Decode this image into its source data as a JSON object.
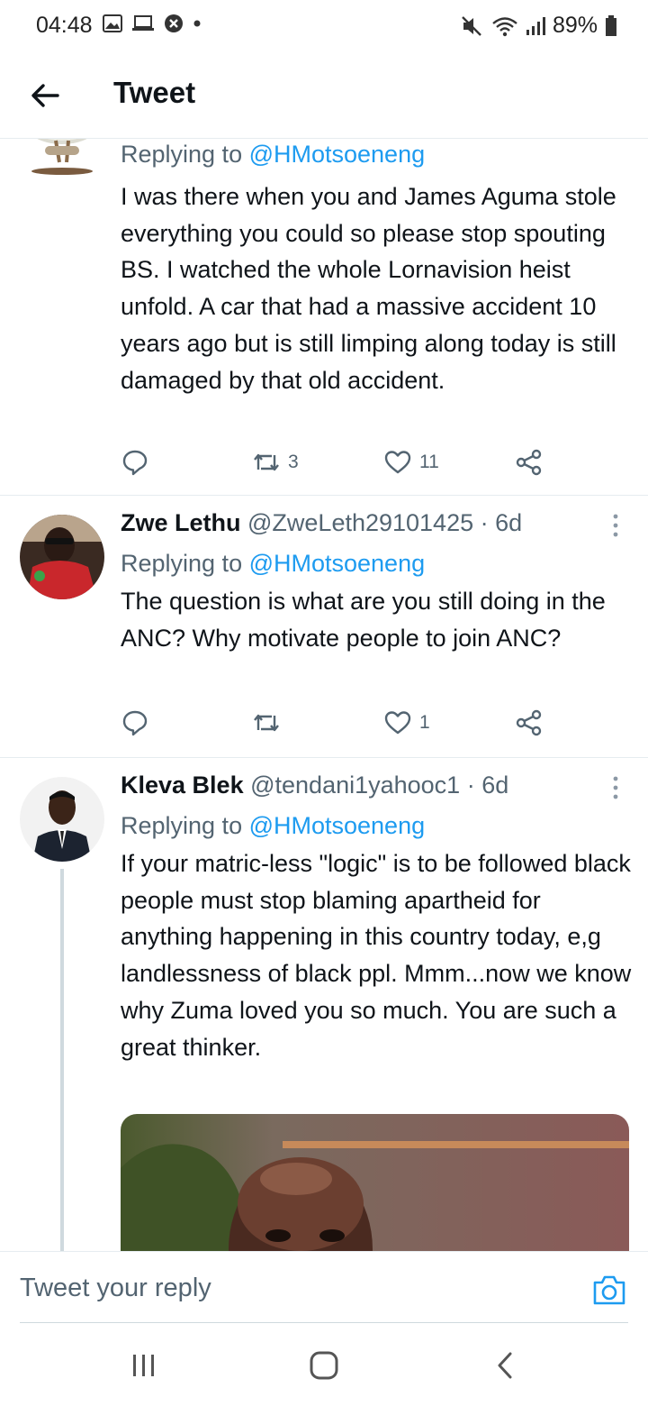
{
  "status_bar": {
    "time": "04:48",
    "battery": "89%"
  },
  "header": {
    "title": "Tweet"
  },
  "tweets": [
    {
      "name": "",
      "handle": "",
      "replying_prefix": "Replying to ",
      "replying_to": "@HMotsoeneng",
      "text": "I was there when you and James Aguma stole everything you could so please stop spouting BS. I watched the whole Lornavision heist unfold. A car that had a massive accident 10 years ago but is still limping along today is still damaged by that old accident.",
      "retweets": "3",
      "likes": "11"
    },
    {
      "name": "Zwe Lethu",
      "handle": "@ZweLeth29101425 · 6d",
      "replying_prefix": "Replying to ",
      "replying_to": "@HMotsoeneng",
      "text": "The question is what are you still doing in the ANC? Why motivate people to join ANC?",
      "retweets": "",
      "likes": "1"
    },
    {
      "name": "Kleva Blek",
      "handle": "@tendani1yahooc1 · 6d",
      "replying_prefix": "Replying to ",
      "replying_to": "@HMotsoeneng",
      "text": "If your matric-less \"logic\" is to be followed black people must stop blaming apartheid for anything happening in this country today, e,g landlessness of black ppl. Mmm...now we know why Zuma loved you so much. You are such a great thinker."
    }
  ],
  "reply_bar": {
    "placeholder": "Tweet your reply"
  },
  "icons": {
    "back": "arrow-left-icon",
    "reply": "reply-bubble-icon",
    "retweet": "retweet-icon",
    "like": "heart-icon",
    "share": "share-icon",
    "more": "more-vertical-icon",
    "camera": "camera-icon"
  },
  "colors": {
    "accent": "#1d9bf0",
    "text": "#0f1419",
    "secondary": "#536471",
    "divider": "#e6ecf0"
  }
}
